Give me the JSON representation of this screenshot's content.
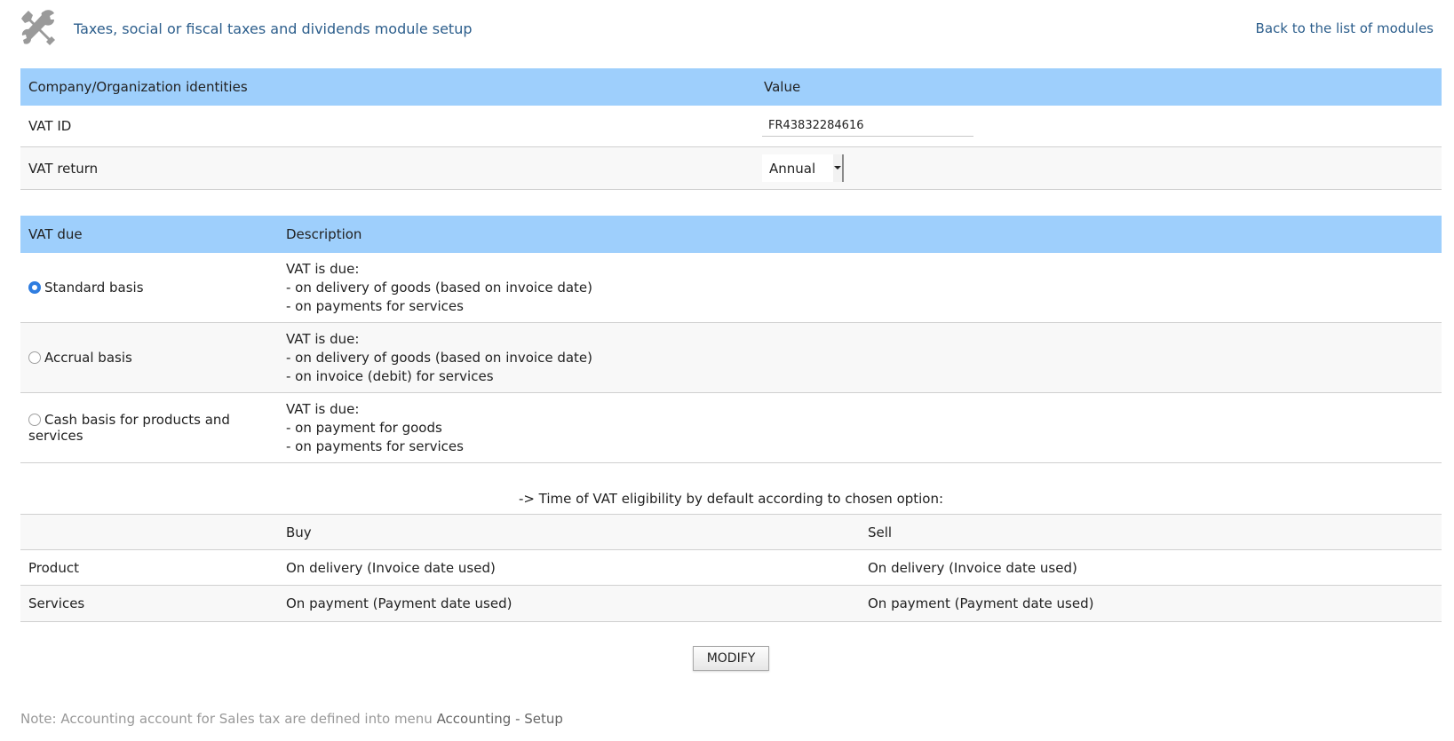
{
  "header": {
    "title": "Taxes, social or fiscal taxes and dividends module setup",
    "back_link": "Back to the list of modules",
    "icon": "tools-icon"
  },
  "identities": {
    "col_label": "Company/Organization identities",
    "col_value": "Value",
    "vat_id_label": "VAT ID",
    "vat_id_value": "FR43832284616",
    "vat_return_label": "VAT return",
    "vat_return_value": "Annual"
  },
  "vat_due": {
    "col_label": "VAT due",
    "col_desc": "Description",
    "options": [
      {
        "label": "Standard basis",
        "checked": true,
        "lines": [
          "VAT is due:",
          "- on delivery of goods (based on invoice date)",
          "- on payments for services"
        ]
      },
      {
        "label": "Accrual basis",
        "checked": false,
        "lines": [
          "VAT is due:",
          "- on delivery of goods (based on invoice date)",
          "- on invoice (debit) for services"
        ]
      },
      {
        "label": "Cash basis for products and services",
        "checked": false,
        "lines": [
          "VAT is due:",
          "- on payment for goods",
          "- on payments for services"
        ]
      }
    ]
  },
  "eligibility": {
    "title": "-> Time of VAT eligibility by default according to chosen option:",
    "col_buy": "Buy",
    "col_sell": "Sell",
    "rows": [
      {
        "label": "Product",
        "buy": "On delivery (Invoice date used)",
        "sell": "On delivery (Invoice date used)"
      },
      {
        "label": "Services",
        "buy": "On payment (Payment date used)",
        "sell": "On payment (Payment date used)"
      }
    ]
  },
  "modify_button": "MODIFY",
  "note": {
    "prefix": "Note: Accounting account for Sales tax are defined into menu ",
    "menu": "Accounting - Setup"
  },
  "colors": {
    "header_bg": "#9ecffc",
    "link": "#2c5e8c",
    "radio_checked": "#2f7de0"
  }
}
